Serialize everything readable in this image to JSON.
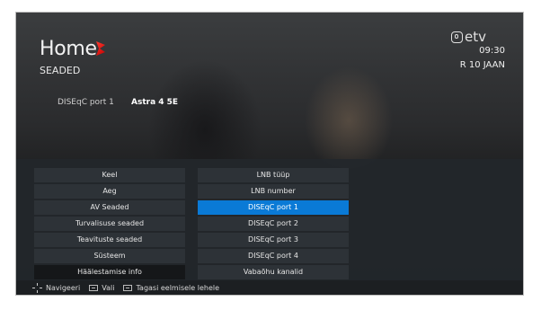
{
  "header": {
    "logo_text": "Home",
    "section_title": "SEADED",
    "brand": "etv",
    "time": "09:30",
    "date": "R 10 JAAN"
  },
  "info": {
    "port_label": "DISEqC port 1",
    "satellite": "Astra 4 5E"
  },
  "menu": {
    "items": [
      {
        "label": "Keel"
      },
      {
        "label": "Aeg"
      },
      {
        "label": "AV Seaded"
      },
      {
        "label": "Turvalisuse seaded"
      },
      {
        "label": "Teavituste seaded"
      },
      {
        "label": "Süsteem"
      },
      {
        "label": "Häälestamise info"
      }
    ]
  },
  "submenu": {
    "items": [
      {
        "label": "LNB tüüp"
      },
      {
        "label": "LNB number"
      },
      {
        "label": "DISEqC port 1"
      },
      {
        "label": "DISEqC port 2"
      },
      {
        "label": "DISEqC port 3"
      },
      {
        "label": "DISEqC port 4"
      },
      {
        "label": "Vabaõhu kanalid"
      }
    ],
    "selected_index": 2
  },
  "hints": {
    "navigate": "Navigeeri",
    "select": "Vali",
    "back": "Tagasi eelmisele lehele"
  },
  "colors": {
    "accent": "#0a7ad6",
    "logo_accent": "#e01010"
  },
  "icons": {
    "logo_mark": "home3-logo-icon",
    "brand": "etv-logo-icon",
    "navigate": "dpad-icon",
    "select": "ok-key-icon",
    "back": "back-key-icon"
  }
}
